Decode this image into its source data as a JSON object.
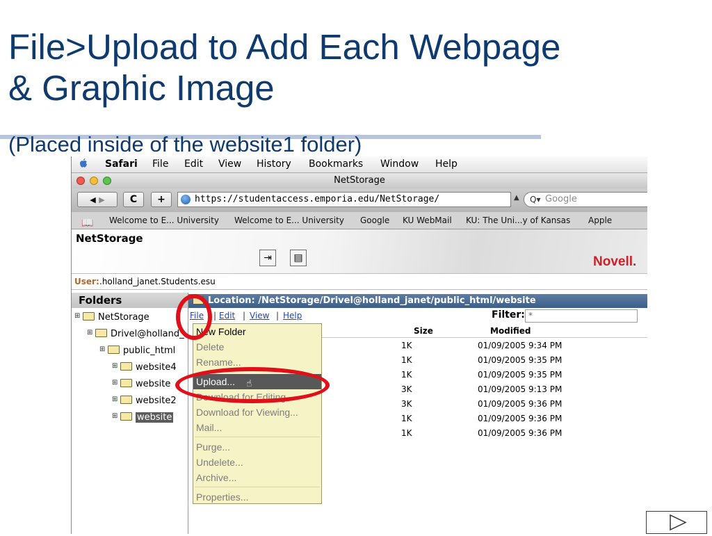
{
  "slide": {
    "title_line1": "File>Upload to Add Each Webpage",
    "title_line2": "& Graphic Image",
    "subtitle": "(Placed inside of the website1 folder)"
  },
  "menubar": {
    "app": "Safari",
    "items": [
      "File",
      "Edit",
      "View",
      "History",
      "Bookmarks",
      "Window",
      "Help"
    ]
  },
  "window": {
    "title": "NetStorage"
  },
  "toolbar": {
    "back_label": "◀",
    "forward_label": "▶",
    "reload_label": "C",
    "add_label": "+",
    "url": "https://studentaccess.emporia.edu/NetStorage/",
    "search_placeholder": "Google"
  },
  "bookmarks": [
    "Welcome to E... University",
    "Welcome to E... University",
    "Google",
    "KU WebMail",
    "KU: The Uni...y of Kansas",
    "Apple"
  ],
  "netstorage": {
    "title": "NetStorage",
    "brand": "Novell.",
    "user_label": "User:",
    "user_value": ".holland_janet.Students.esu"
  },
  "folders": {
    "heading": "Folders",
    "items": [
      "NetStorage",
      "Drivel@holland_",
      "public_html",
      "website4",
      "website",
      "website2",
      "website"
    ]
  },
  "content": {
    "location": "Location: /NetStorage/Drivel@holland_janet/public_html/website",
    "menus": [
      "File",
      "Edit",
      "View",
      "Help"
    ],
    "filter_label": "Filter:",
    "filter_value": "*",
    "col_size": "Size",
    "col_modified": "Modified",
    "rows": [
      {
        "size": "1K",
        "modified": "01/09/2005 9:34 PM"
      },
      {
        "size": "1K",
        "modified": "01/09/2005 9:35 PM"
      },
      {
        "size": "1K",
        "modified": "01/09/2005 9:35 PM"
      },
      {
        "size": "3K",
        "modified": "01/09/2005 9:13 PM"
      },
      {
        "size": "3K",
        "modified": "01/09/2005 9:36 PM"
      },
      {
        "size": "1K",
        "modified": "01/09/2005 9:36 PM"
      },
      {
        "size": "1K",
        "modified": "01/09/2005 9:36 PM"
      }
    ]
  },
  "file_menu": {
    "items": [
      "New Folder",
      "Delete",
      "Rename...",
      "Upload...",
      "Download for Editing...",
      "Download for Viewing...",
      "Mail...",
      "Purge...",
      "Undelete...",
      "Archive...",
      "Properties..."
    ]
  },
  "colors": {
    "title": "#0f3a6e",
    "annotation_red": "#e0101a",
    "menu_background": "#f6f3c7",
    "highlight": "#585858"
  }
}
